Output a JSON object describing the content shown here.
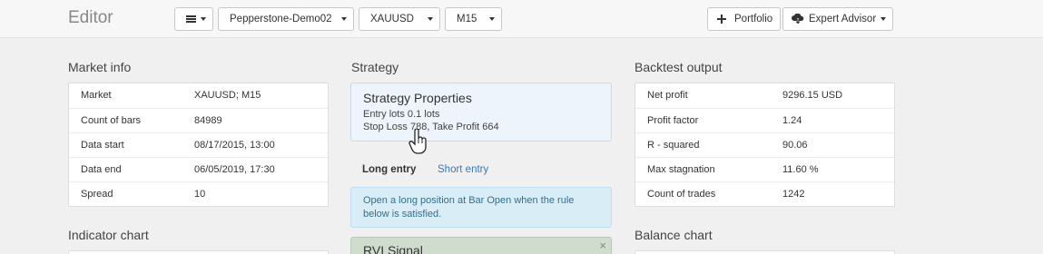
{
  "header": {
    "title": "Editor",
    "menu_icon": "hamburger-icon",
    "account": "Pepperstone-Demo02",
    "symbol": "XAUUSD",
    "timeframe": "M15",
    "portfolio_label": "Portfolio",
    "expert_label": "Expert Advisor",
    "expert_icon": "cloud-download-icon"
  },
  "market_info": {
    "title": "Market info",
    "rows": [
      {
        "label": "Market",
        "value": "XAUUSD; M15"
      },
      {
        "label": "Count of bars",
        "value": "84989"
      },
      {
        "label": "Data start",
        "value": "08/17/2015, 13:00"
      },
      {
        "label": "Data end",
        "value": "06/05/2019, 17:30"
      },
      {
        "label": "Spread",
        "value": "10"
      }
    ]
  },
  "strategy": {
    "title": "Strategy",
    "properties_title": "Strategy Properties",
    "line1": "Entry lots 0.1 lots",
    "line2": "Stop Loss 788, Take Profit 664",
    "tabs": [
      "Long entry",
      "Short entry"
    ],
    "info_line1": "Open a long position at Bar Open when the rule",
    "info_line2": "below is satisfied.",
    "rule_title": "RVI Signal",
    "rule_close": "×"
  },
  "backtest": {
    "title": "Backtest output",
    "rows": [
      {
        "label": "Net profit",
        "value": "9296.15 USD"
      },
      {
        "label": "Profit factor",
        "value": "1.24"
      },
      {
        "label": "R - squared",
        "value": "90.06"
      },
      {
        "label": "Max stagnation",
        "value": "11.60 %"
      },
      {
        "label": "Count of trades",
        "value": "1242"
      }
    ]
  },
  "indicator_chart": {
    "title": "Indicator chart"
  },
  "balance_chart": {
    "title": "Balance chart"
  },
  "colors": {
    "link": "#3a7ab8",
    "info_bg": "#d9edf7",
    "rule_bg": "#cfddcd"
  }
}
